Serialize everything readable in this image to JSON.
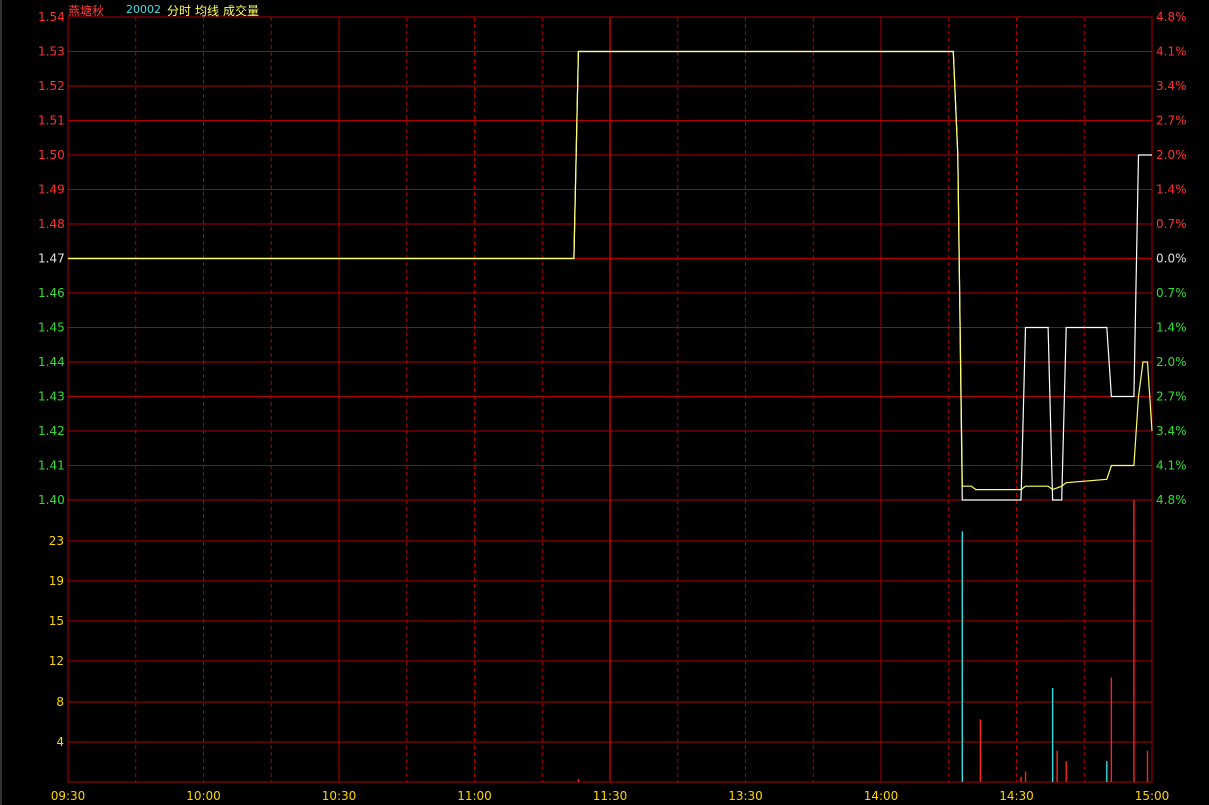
{
  "header": {
    "name": "燕塘秋",
    "code": "20002",
    "labels": [
      "分时",
      "均线",
      "成交量"
    ]
  },
  "colors": {
    "background": "#000000",
    "grid": "#b00000",
    "price_line": "#ffffff",
    "avg_line": "#ffff66",
    "up": "#ff3030",
    "down": "#33dd33",
    "flat": "#e0e0e0",
    "volume_label": "#ffd700",
    "time_label": "#ffd700",
    "volume_up": "#ff2020",
    "volume_down": "#33dddd",
    "name": "#ff4040",
    "code": "#40e0e0",
    "menu": "#ffff66"
  },
  "chart_data": {
    "type": "line",
    "prev_close": 1.47,
    "price_ticks": [
      "1.54",
      "1.53",
      "1.52",
      "1.51",
      "1.50",
      "1.49",
      "1.48",
      "1.47",
      "1.46",
      "1.45",
      "1.44",
      "1.43",
      "1.42",
      "1.41",
      "1.40"
    ],
    "pct_ticks": [
      "4.8%",
      "4.1%",
      "3.4%",
      "2.7%",
      "2.0%",
      "1.4%",
      "0.7%",
      "0.0%",
      "0.7%",
      "1.4%",
      "2.0%",
      "2.7%",
      "3.4%",
      "4.1%",
      "4.8%"
    ],
    "volume_ticks": [
      "23",
      "19",
      "15",
      "12",
      "8",
      "4"
    ],
    "time_labels": [
      "09:30",
      "10:00",
      "10:30",
      "11:00",
      "11:30",
      "13:30",
      "14:00",
      "14:30",
      "15:00"
    ],
    "ylim": [
      1.4,
      1.54
    ],
    "volume_ylim": [
      0,
      27
    ],
    "minutes": 240,
    "series": [
      {
        "name": "分时",
        "points": [
          [
            0,
            1.47
          ],
          [
            112,
            1.47
          ],
          [
            113,
            1.53
          ],
          [
            196,
            1.53
          ],
          [
            197,
            1.5
          ],
          [
            198,
            1.4
          ],
          [
            211,
            1.4
          ],
          [
            212,
            1.45
          ],
          [
            217,
            1.45
          ],
          [
            218,
            1.4
          ],
          [
            220,
            1.4
          ],
          [
            221,
            1.45
          ],
          [
            230,
            1.45
          ],
          [
            231,
            1.43
          ],
          [
            236,
            1.43
          ],
          [
            237,
            1.5
          ],
          [
            240,
            1.5
          ]
        ]
      },
      {
        "name": "均线",
        "points": [
          [
            0,
            1.47
          ],
          [
            112,
            1.47
          ],
          [
            113,
            1.53
          ],
          [
            196,
            1.53
          ],
          [
            197,
            1.5
          ],
          [
            198,
            1.404
          ],
          [
            200,
            1.404
          ],
          [
            201,
            1.403
          ],
          [
            211,
            1.403
          ],
          [
            212,
            1.404
          ],
          [
            217,
            1.404
          ],
          [
            218,
            1.403
          ],
          [
            220,
            1.404
          ],
          [
            221,
            1.405
          ],
          [
            230,
            1.406
          ],
          [
            231,
            1.41
          ],
          [
            236,
            1.41
          ],
          [
            237,
            1.43
          ],
          [
            238,
            1.44
          ],
          [
            239,
            1.44
          ],
          [
            240,
            1.42
          ]
        ]
      }
    ],
    "volume": [
      {
        "minute": 113,
        "value": 0.3,
        "dir": "up"
      },
      {
        "minute": 198,
        "value": 24,
        "dir": "down"
      },
      {
        "minute": 202,
        "value": 6,
        "dir": "up"
      },
      {
        "minute": 211,
        "value": 0.5,
        "dir": "up"
      },
      {
        "minute": 212,
        "value": 1,
        "dir": "up"
      },
      {
        "minute": 218,
        "value": 9,
        "dir": "down"
      },
      {
        "minute": 219,
        "value": 3,
        "dir": "up"
      },
      {
        "minute": 221,
        "value": 2,
        "dir": "up"
      },
      {
        "minute": 230,
        "value": 2,
        "dir": "down"
      },
      {
        "minute": 231,
        "value": 10,
        "dir": "up"
      },
      {
        "minute": 236,
        "value": 27,
        "dir": "up"
      },
      {
        "minute": 239,
        "value": 3,
        "dir": "up"
      }
    ]
  }
}
